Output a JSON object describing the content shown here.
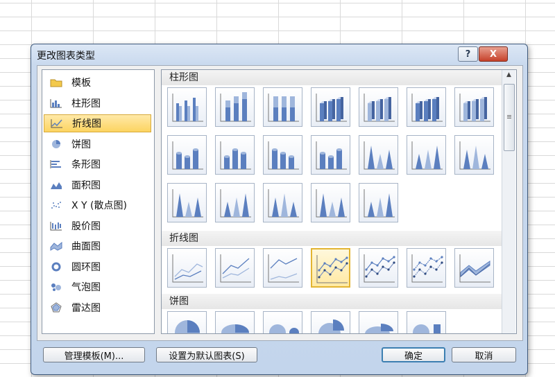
{
  "dialog": {
    "title": "更改图表类型",
    "help_label": "?",
    "close_label": "X"
  },
  "categories": [
    {
      "label": "模板",
      "icon": "folder-icon"
    },
    {
      "label": "柱形图",
      "icon": "column-chart-icon"
    },
    {
      "label": "折线图",
      "icon": "line-chart-icon",
      "selected": true
    },
    {
      "label": "饼图",
      "icon": "pie-chart-icon"
    },
    {
      "label": "条形图",
      "icon": "bar-chart-icon"
    },
    {
      "label": "面积图",
      "icon": "area-chart-icon"
    },
    {
      "label": "X Y (散点图)",
      "icon": "scatter-chart-icon"
    },
    {
      "label": "股价图",
      "icon": "stock-chart-icon"
    },
    {
      "label": "曲面图",
      "icon": "surface-chart-icon"
    },
    {
      "label": "圆环图",
      "icon": "doughnut-chart-icon"
    },
    {
      "label": "气泡图",
      "icon": "bubble-chart-icon"
    },
    {
      "label": "雷达图",
      "icon": "radar-chart-icon"
    }
  ],
  "sections": {
    "column": {
      "title": "柱形图",
      "subtypes": [
        "clustered-column",
        "stacked-column",
        "100-stacked-column",
        "3d-clustered-column",
        "3d-stacked-column",
        "3d-100-stacked-column",
        "3d-column",
        "clustered-cylinder",
        "stacked-cylinder",
        "100-stacked-cylinder",
        "3d-cylinder",
        "clustered-cone",
        "stacked-cone",
        "100-stacked-cone",
        "3d-cone",
        "clustered-pyramid",
        "stacked-pyramid",
        "100-stacked-pyramid",
        "3d-pyramid"
      ]
    },
    "line": {
      "title": "折线图",
      "subtypes": [
        "line",
        "stacked-line",
        "100-stacked-line",
        "line-with-markers",
        "stacked-line-with-markers",
        "100-stacked-line-with-markers",
        "3d-line"
      ],
      "selected_index": 3
    },
    "pie": {
      "title": "饼图",
      "subtypes": [
        "pie",
        "3d-pie",
        "pie-of-pie",
        "exploded-pie",
        "3d-exploded-pie",
        "bar-of-pie"
      ]
    }
  },
  "buttons": {
    "manage_templates": "管理模板(M)...",
    "set_default": "设置为默认图表(S)",
    "ok": "确定",
    "cancel": "取消"
  },
  "colors": {
    "selection": "#fcd461",
    "accent_blue": "#5b7fbf"
  }
}
